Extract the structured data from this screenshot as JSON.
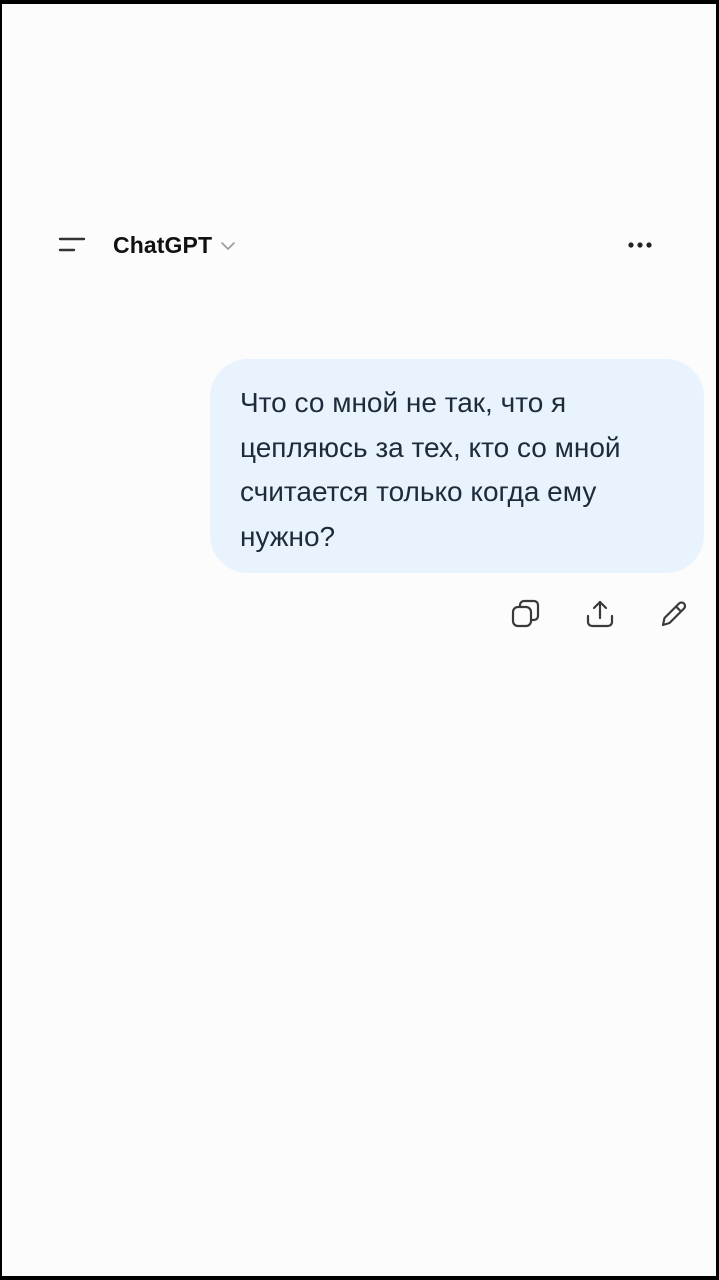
{
  "header": {
    "title": "ChatGPT",
    "menu_icon": "sidebar-menu-icon",
    "dropdown_icon": "chevron-down-icon",
    "more_icon": "more-horizontal-icon"
  },
  "message": {
    "role": "user",
    "text": "Что со мной не так, что я цепляюсь за тех, кто со мной считается только когда ему нужно?"
  },
  "message_actions": [
    {
      "icon": "copy-icon"
    },
    {
      "icon": "share-icon"
    },
    {
      "icon": "edit-icon"
    }
  ],
  "colors": {
    "background": "#fcfcfc",
    "bubble": "#e8f3fd",
    "text": "#1f2a3a",
    "icon": "#3a3a3a"
  }
}
